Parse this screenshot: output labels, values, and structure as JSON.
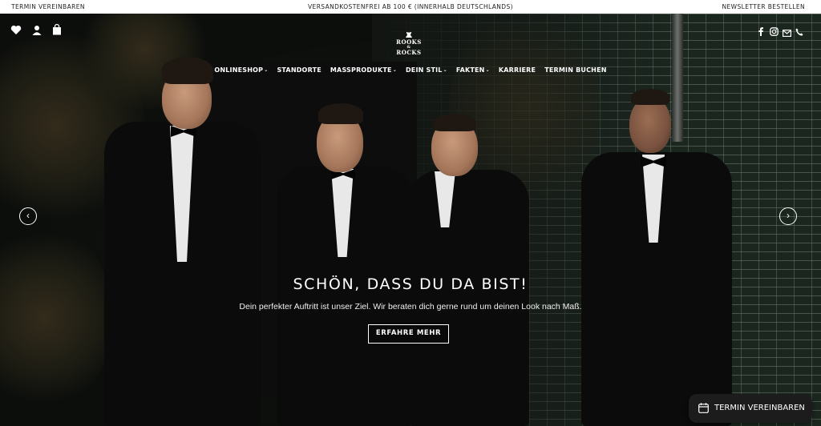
{
  "topbar": {
    "left": "TERMIN VEREINBAREN",
    "center": "VERSANDKOSTENFREI AB 100 € (INNERHALB DEUTSCHLANDS)",
    "right": "NEWSLETTER BESTELLEN"
  },
  "header": {
    "icons_left": [
      "heart-icon",
      "user-icon",
      "bag-icon"
    ],
    "logo": {
      "line1": "ROOKS",
      "line2": "&",
      "line3": "ROCKS"
    },
    "nav": [
      {
        "label": "ONLINESHOP",
        "has_dropdown": true
      },
      {
        "label": "STANDORTE",
        "has_dropdown": false
      },
      {
        "label": "MASSPRODUKTE",
        "has_dropdown": true
      },
      {
        "label": "DEIN STIL",
        "has_dropdown": true
      },
      {
        "label": "FAKTEN",
        "has_dropdown": true
      },
      {
        "label": "KARRIERE",
        "has_dropdown": false
      },
      {
        "label": "TERMIN BUCHEN",
        "has_dropdown": false
      }
    ],
    "social_icons": [
      "facebook-icon",
      "instagram-icon",
      "email-icon",
      "phone-icon"
    ]
  },
  "hero": {
    "title": "SCHÖN, DASS DU DA BIST!",
    "subtitle": "Dein perfekter Auftritt ist unser Ziel. Wir beraten dich gerne rund um deinen Look nach Maß.",
    "cta": "ERFAHRE MEHR",
    "prev_icon": "chevron-left-icon",
    "next_icon": "chevron-right-icon"
  },
  "floating_button": {
    "label": "TERMIN VEREINBAREN",
    "icon": "calendar-icon"
  },
  "colors": {
    "topbar_bg": "#ffffff",
    "hero_bg": "#121512",
    "text_on_hero": "#ffffff",
    "float_bg": "#1c1c1c"
  }
}
